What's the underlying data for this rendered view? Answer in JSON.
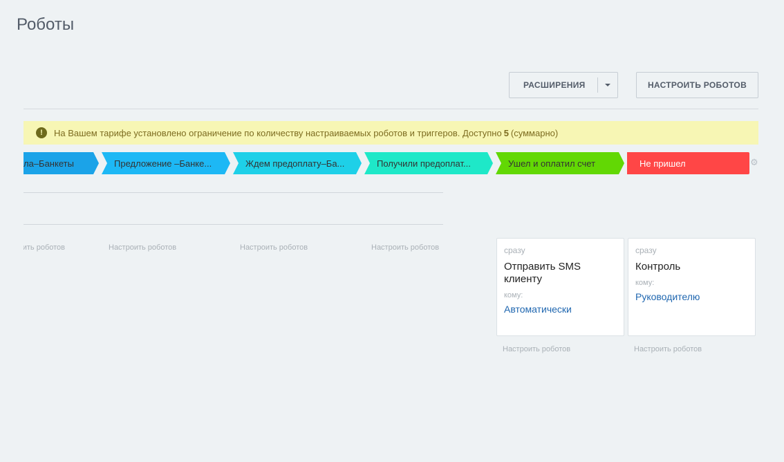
{
  "page": {
    "title": "Роботы"
  },
  "toolbar": {
    "extensions_label": "РАСШИРЕНИЯ",
    "configure_label": "НАСТРОИТЬ РОБОТОВ"
  },
  "warning": {
    "text_before": "На Вашем тарифе установлено ограничение по количеству настраиваемых роботов и триггеров. Доступно",
    "limit": "5",
    "text_after": "(суммарно)"
  },
  "stages": [
    {
      "label": "ла–Банкеты",
      "color": "#1ba3e8"
    },
    {
      "label": "Предложение –Банке...",
      "color": "#1db8f5"
    },
    {
      "label": "Ждем предоплату–Ба...",
      "color": "#1ed0e8"
    },
    {
      "label": "Получили предоплат...",
      "color": "#1ee8c8"
    },
    {
      "label": "Ушел и оплатил счет",
      "color": "#62d804"
    },
    {
      "label": "Не пришел",
      "color": "#ff4646"
    }
  ],
  "columns": {
    "configure_link": "Настроить роботов"
  },
  "robots": [
    {
      "delay": "сразу",
      "title": "Отправить SMS клиенту",
      "to_label": "кому:",
      "to_value": "Автоматически"
    },
    {
      "delay": "сразу",
      "title": "Контроль",
      "to_label": "кому:",
      "to_value": "Руководителю"
    }
  ]
}
